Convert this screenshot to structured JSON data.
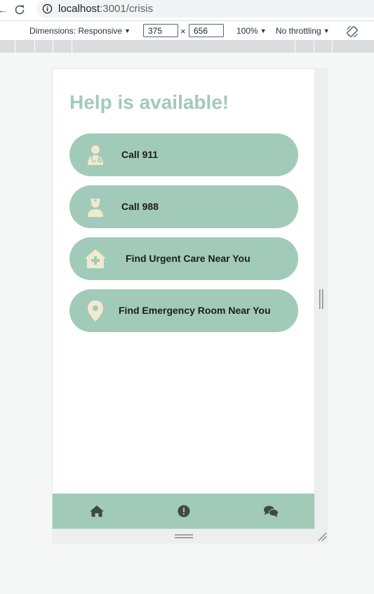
{
  "browser": {
    "url_host": "localhost",
    "url_path": ":3001/crisis"
  },
  "devtools": {
    "dimensions_label": "Dimensions: Responsive",
    "width_value": "375",
    "times_symbol": "×",
    "height_value": "656",
    "zoom_label": "100%",
    "throttling_label": "No throttling"
  },
  "page": {
    "title": "Help is available!",
    "buttons": [
      {
        "label": "Call 911",
        "icon": "doctor-icon"
      },
      {
        "label": "Call 988",
        "icon": "nurse-icon"
      },
      {
        "label": "Find Urgent Care Near You",
        "icon": "clinic-icon"
      },
      {
        "label": "Find Emergency Room Near You",
        "icon": "location-pin-icon"
      }
    ],
    "nav": [
      {
        "icon": "home-icon"
      },
      {
        "icon": "alert-icon"
      },
      {
        "icon": "chat-icon"
      }
    ]
  },
  "colors": {
    "accent": "#a2cab9",
    "icon_fill": "#f1ead0",
    "nav_icon": "#3c4a46"
  }
}
